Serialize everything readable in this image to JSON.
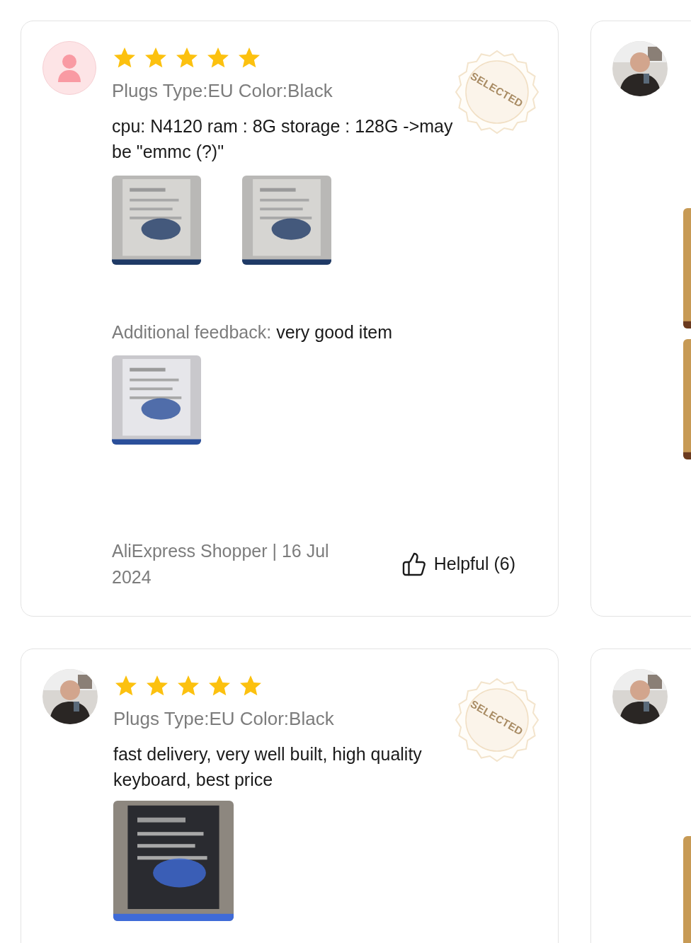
{
  "reviews": [
    {
      "avatar": {
        "kind": "placeholder"
      },
      "stars": 5,
      "variant": "Plugs Type:EU Color:Black",
      "badge": "SELECTED",
      "body": "cpu: N4120 ram : 8G storage : 128G ->may be \"emmc (?)\"",
      "images": [
        {
          "kind": "document"
        },
        {
          "kind": "document"
        }
      ],
      "feedback": {
        "label": "Additional feedback:",
        "text": "very good item",
        "images": [
          {
            "kind": "screen"
          }
        ]
      },
      "byline": "AliExpress Shopper | 16 Jul 2024",
      "helpful": "Helpful (6)"
    },
    {
      "avatar": {
        "kind": "picture"
      },
      "images": [
        {
          "kind": "picture"
        },
        {
          "kind": "picture"
        }
      ]
    },
    {
      "avatar": {
        "kind": "picture"
      },
      "stars": 5,
      "variant": "Plugs Type:EU Color:Black",
      "badge": "SELECTED",
      "body": "fast delivery, very well built, high quality keyboard, best price",
      "images": [
        {
          "kind": "laptop"
        }
      ]
    },
    {
      "avatar": {
        "kind": "picture"
      },
      "images": [
        {
          "kind": "picture"
        }
      ]
    }
  ]
}
